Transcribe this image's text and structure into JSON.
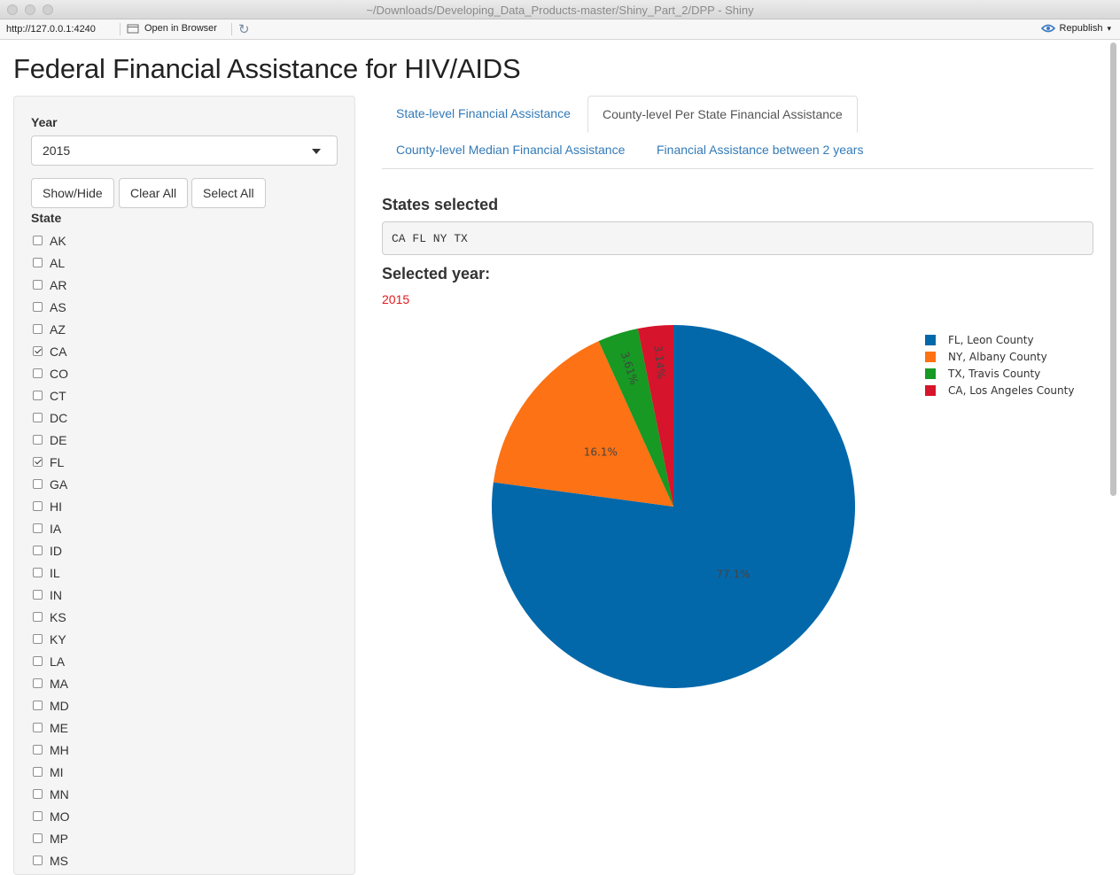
{
  "window": {
    "title": "~/Downloads/Developing_Data_Products-master/Shiny_Part_2/DPP - Shiny"
  },
  "toolbar": {
    "url": "http://127.0.0.1:4240",
    "open_browser_label": "Open in Browser",
    "republish_label": "Republish"
  },
  "app": {
    "title": "Federal Financial Assistance for HIV/AIDS"
  },
  "sidebar": {
    "year_label": "Year",
    "year_value": "2015",
    "buttons": {
      "show_hide": "Show/Hide",
      "clear_all": "Clear All",
      "select_all": "Select All"
    },
    "state_label": "State",
    "states": [
      {
        "code": "AK",
        "checked": false
      },
      {
        "code": "AL",
        "checked": false
      },
      {
        "code": "AR",
        "checked": false
      },
      {
        "code": "AS",
        "checked": false
      },
      {
        "code": "AZ",
        "checked": false
      },
      {
        "code": "CA",
        "checked": true
      },
      {
        "code": "CO",
        "checked": false
      },
      {
        "code": "CT",
        "checked": false
      },
      {
        "code": "DC",
        "checked": false
      },
      {
        "code": "DE",
        "checked": false
      },
      {
        "code": "FL",
        "checked": true
      },
      {
        "code": "GA",
        "checked": false
      },
      {
        "code": "HI",
        "checked": false
      },
      {
        "code": "IA",
        "checked": false
      },
      {
        "code": "ID",
        "checked": false
      },
      {
        "code": "IL",
        "checked": false
      },
      {
        "code": "IN",
        "checked": false
      },
      {
        "code": "KS",
        "checked": false
      },
      {
        "code": "KY",
        "checked": false
      },
      {
        "code": "LA",
        "checked": false
      },
      {
        "code": "MA",
        "checked": false
      },
      {
        "code": "MD",
        "checked": false
      },
      {
        "code": "ME",
        "checked": false
      },
      {
        "code": "MH",
        "checked": false
      },
      {
        "code": "MI",
        "checked": false
      },
      {
        "code": "MN",
        "checked": false
      },
      {
        "code": "MO",
        "checked": false
      },
      {
        "code": "MP",
        "checked": false
      },
      {
        "code": "MS",
        "checked": false
      }
    ]
  },
  "main": {
    "tabs": [
      {
        "label": "State-level Financial Assistance",
        "active": false
      },
      {
        "label": "County-level Per State Financial Assistance",
        "active": true
      },
      {
        "label": "County-level Median Financial Assistance",
        "active": false
      },
      {
        "label": "Financial Assistance between 2 years",
        "active": false
      }
    ],
    "states_selected_title": "States selected",
    "states_selected_value": "CA FL NY TX",
    "selected_year_title": "Selected year:",
    "selected_year_value": "2015"
  },
  "colors": {
    "accent_link": "#337ab7",
    "year_value": "#e31a1c"
  },
  "chart_data": {
    "type": "pie",
    "categories": [
      "FL, Leon County",
      "NY, Albany County",
      "TX, Travis County",
      "CA, Los Angeles County"
    ],
    "values": [
      77.1,
      16.1,
      3.61,
      3.14
    ],
    "labels": [
      "77.1%",
      "16.1%",
      "3.61%",
      "3.14%"
    ],
    "colors": [
      "#0368aa",
      "#fd7214",
      "#179923",
      "#d6142b"
    ],
    "legend": "top-right"
  }
}
